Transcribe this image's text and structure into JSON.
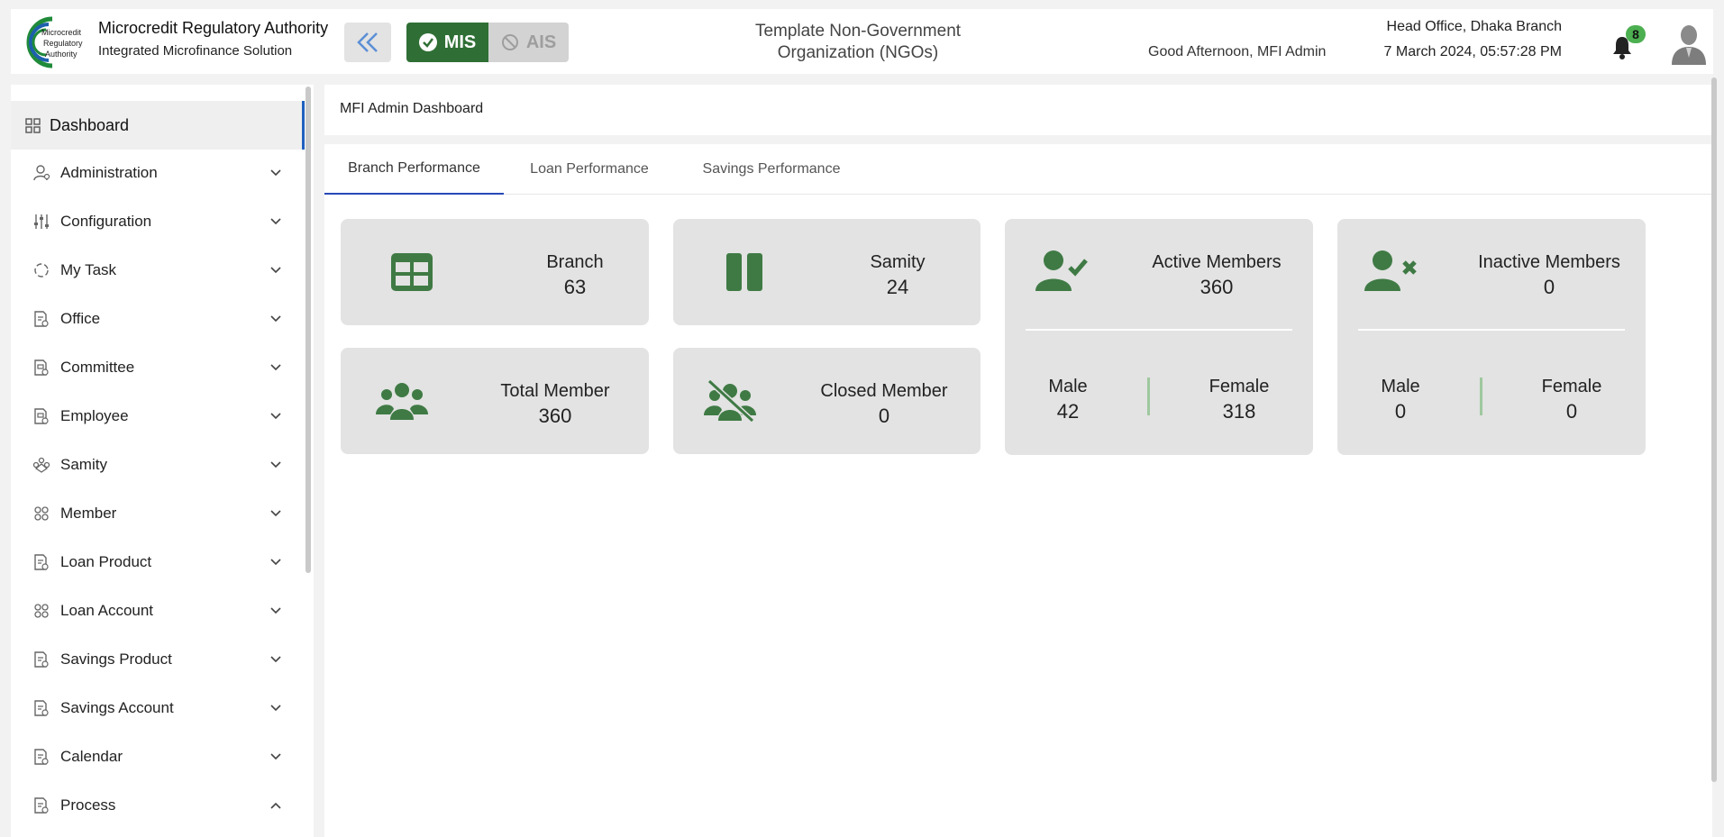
{
  "header": {
    "org_name": "Microcredit Regulatory Authority",
    "org_subtitle": "Integrated Microfinance Solution",
    "logo_text_1": "Microcredit",
    "logo_text_2": "Regulatory",
    "logo_text_3": "Authority",
    "mode_mis": "MIS",
    "mode_ais": "AIS",
    "organization_title": "Template Non-Government Organization (NGOs)",
    "greeting": "Good Afternoon, MFI Admin",
    "branch": "Head Office, Dhaka Branch",
    "datetime": "7 March 2024, 05:57:28 PM",
    "notification_count": "8",
    "colors": {
      "primary_green": "#2f6f35",
      "icon_green": "#3f7a44",
      "badge_green": "#4caf50",
      "active_tab": "#2848b8"
    }
  },
  "sidebar": {
    "dashboard_label": "Dashboard",
    "items": [
      {
        "label": "Administration",
        "icon": "admin-user-icon",
        "expanded": false
      },
      {
        "label": "Configuration",
        "icon": "sliders-icon",
        "expanded": false
      },
      {
        "label": "My Task",
        "icon": "task-cycle-icon",
        "expanded": false
      },
      {
        "label": "Office",
        "icon": "document-icon",
        "expanded": false
      },
      {
        "label": "Committee",
        "icon": "committee-icon",
        "expanded": false
      },
      {
        "label": "Employee",
        "icon": "employee-icon",
        "expanded": false
      },
      {
        "label": "Samity",
        "icon": "samity-icon",
        "expanded": false
      },
      {
        "label": "Member",
        "icon": "members-icon",
        "expanded": false
      },
      {
        "label": "Loan Product",
        "icon": "document-icon",
        "expanded": false
      },
      {
        "label": "Loan Account",
        "icon": "members-icon",
        "expanded": false
      },
      {
        "label": "Savings Product",
        "icon": "document-icon",
        "expanded": false
      },
      {
        "label": "Savings Account",
        "icon": "document-icon",
        "expanded": false
      },
      {
        "label": "Calendar",
        "icon": "document-icon",
        "expanded": false
      },
      {
        "label": "Process",
        "icon": "document-icon",
        "expanded": true
      }
    ]
  },
  "main": {
    "breadcrumb": "MFI Admin Dashboard",
    "tabs": [
      {
        "label": "Branch Performance",
        "active": true
      },
      {
        "label": "Loan Performance",
        "active": false
      },
      {
        "label": "Savings Performance",
        "active": false
      }
    ],
    "cards": {
      "branch": {
        "title": "Branch",
        "value": "63"
      },
      "samity": {
        "title": "Samity",
        "value": "24"
      },
      "total_member": {
        "title": "Total Member",
        "value": "360"
      },
      "closed_member": {
        "title": "Closed Member",
        "value": "0"
      },
      "active_members": {
        "title": "Active Members",
        "value": "360",
        "male_label": "Male",
        "male_value": "42",
        "female_label": "Female",
        "female_value": "318"
      },
      "inactive_members": {
        "title": "Inactive Members",
        "value": "0",
        "male_label": "Male",
        "male_value": "0",
        "female_label": "Female",
        "female_value": "0"
      }
    }
  }
}
